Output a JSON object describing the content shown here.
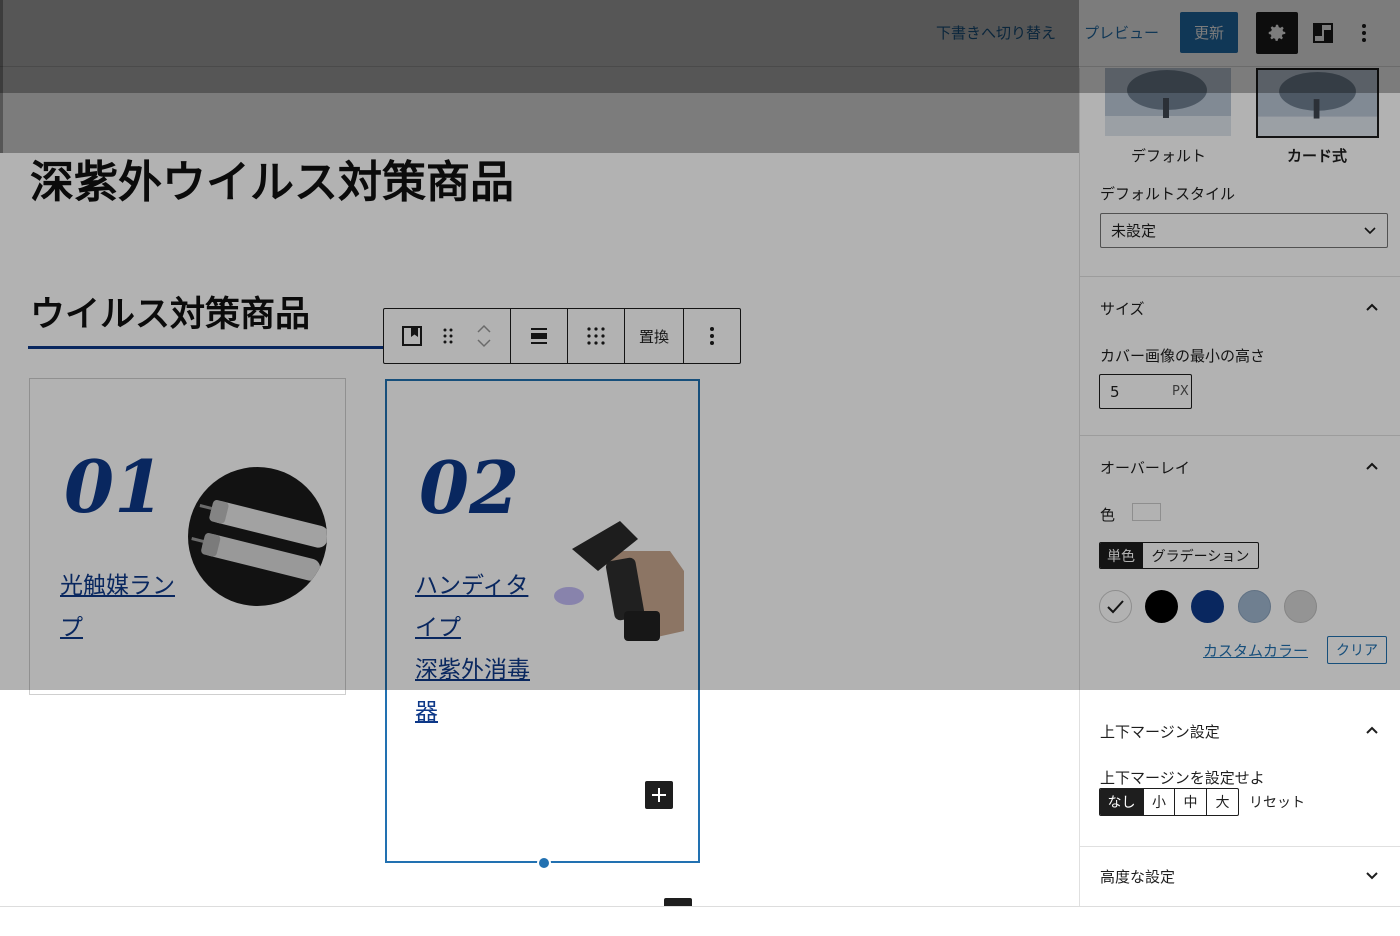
{
  "topbar": {
    "switch_to_draft": "下書きへ切り替え",
    "preview": "プレビュー",
    "update": "更新"
  },
  "editor": {
    "page_title": "深紫外ウイルス対策商品",
    "section_heading": "ウイルス対策商品",
    "cards": [
      {
        "number": "01",
        "link_lines": [
          "光触媒ラン",
          "プ"
        ]
      },
      {
        "number": "02",
        "link_lines": [
          "ハンディタ",
          "イプ",
          "深紫外消毒",
          "器"
        ]
      }
    ],
    "toolbar": {
      "replace": "置換"
    }
  },
  "sidebar": {
    "styles": {
      "default_label": "デフォルト",
      "card_label": "カード式"
    },
    "default_style_label": "デフォルトスタイル",
    "default_style_value": "未設定",
    "size_panel": {
      "title": "サイズ",
      "min_height_label": "カバー画像の最小の高さ",
      "min_height_value": "5",
      "unit": "PX"
    },
    "overlay_panel": {
      "title": "オーバーレイ",
      "color_label": "色",
      "tab_solid": "単色",
      "tab_gradient": "グラデーション",
      "swatches": [
        "#ffffff",
        "#000000",
        "#0d3888",
        "#9fb6cf",
        "#d4d4d4"
      ],
      "custom_color": "カスタムカラー",
      "clear": "クリア"
    },
    "margin_panel": {
      "title": "上下マージン設定",
      "help": "上下マージンを設定せよ",
      "options": [
        "なし",
        "小",
        "中",
        "大"
      ],
      "selected": "なし",
      "reset": "リセット"
    },
    "advanced_panel": {
      "title": "高度な設定"
    }
  },
  "colors": {
    "accent": "#2271b1",
    "brand_navy": "#0d3888"
  }
}
